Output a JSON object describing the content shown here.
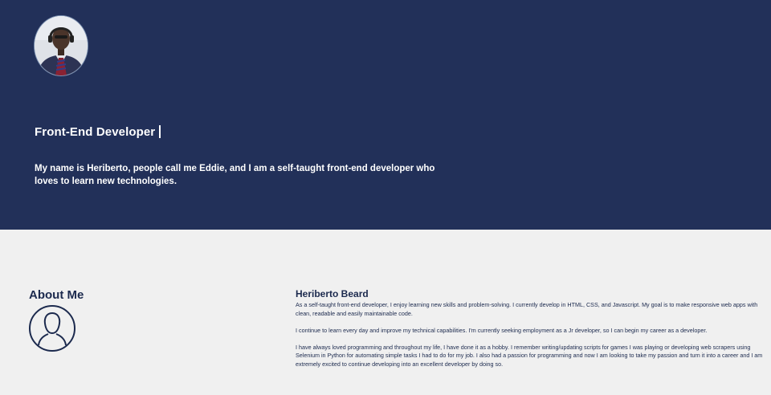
{
  "hero": {
    "avatar_alt": "profile-photo",
    "title": "Front-End Developer",
    "intro": "My name is Heriberto, people call me Eddie, and I am a self-taught front-end developer who loves to learn new technologies."
  },
  "about": {
    "heading": "About Me",
    "icon": "user-icon",
    "name": "Heriberto Beard",
    "paragraphs": [
      "As a self-taught front-end developer, I enjoy learning new skills and problem-solving. I currently develop in HTML, CSS, and Javascript. My goal is to make responsive web apps with clean, readable and easily maintainable code.",
      "I continue to learn every day and improve my technical capabilities. I'm currently seeking employment as a Jr developer, so I can begin my career as a developer.",
      "I have always loved programming and throughout my life, I have done it as a hobby. I remember writing/updating scripts for games I was playing or developing web scrapers using Selenium in Python for automating simple tasks I had to do for my job. I also had a passion for programming and now I am looking to take my passion and turn it into a career and I am extremely excited to continue developing into an excellent developer by doing so."
    ]
  },
  "colors": {
    "hero_bg": "#223059",
    "about_bg": "#f0f0f0",
    "accent_text": "#1c2a4e"
  }
}
